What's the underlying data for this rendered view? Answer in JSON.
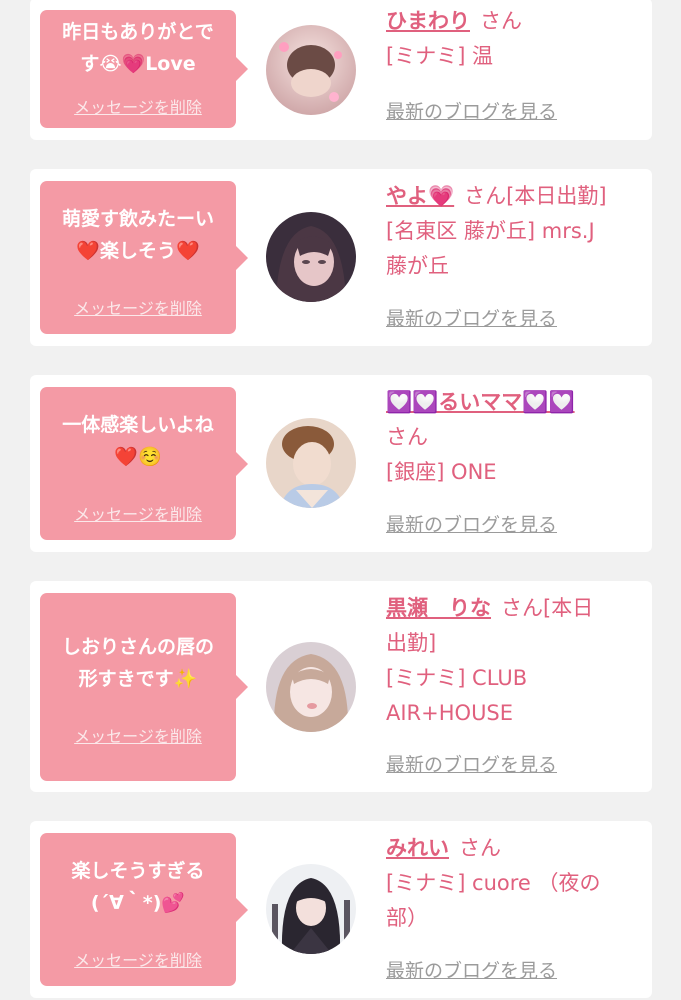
{
  "delete_label": "メッセージを削除",
  "blog_label": "最新のブログを見る",
  "san_label": "さん",
  "colors": {
    "bubble": "#f49aa5",
    "name": "#e0607e",
    "link_gray": "#9b9b9b",
    "background": "#f1f1f1"
  },
  "entries": [
    {
      "message_line1": "昨日もありがとで",
      "message_line2": "す😭💗Love",
      "name": "ひまわり",
      "extra": "",
      "store_line1": "[ミナミ] 温",
      "store_line2": ""
    },
    {
      "message_line1": "萌愛す飲みたーい",
      "message_line2": "❤️楽しそう❤️",
      "name": "やよ💗",
      "extra": "[本日出勤]",
      "store_line1": "[名東区 藤が丘] mrs.J",
      "store_line2": "藤が丘"
    },
    {
      "message_line1": "一体感楽しいよね",
      "message_line2": "❤️☺️",
      "name": "💟💟るいママ💟💟",
      "extra": "",
      "store_line1": "[銀座] ONE",
      "store_line2": ""
    },
    {
      "message_line1": "しおりさんの唇の",
      "message_line2": "形すきです✨",
      "name": "黒瀬　りな",
      "extra": "[本日",
      "extra_line2": "出勤]",
      "store_line1": "[ミナミ] CLUB",
      "store_line2": "AIR+HOUSE"
    },
    {
      "message_line1": "楽しそうすぎる",
      "message_line2": "(´∀｀*)💕",
      "name": "みれい",
      "extra": "",
      "store_line1": "[ミナミ] cuore （夜の",
      "store_line2": "部）"
    }
  ]
}
